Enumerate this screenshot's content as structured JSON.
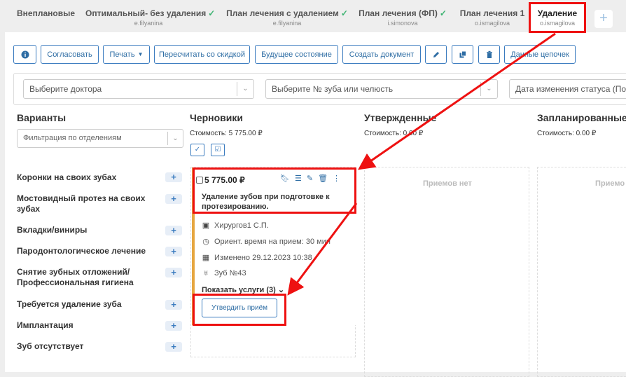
{
  "tabs": [
    {
      "title": "Внеплановые",
      "sub": "",
      "check": false
    },
    {
      "title": "Оптимальный- без удаления",
      "sub": "e.filyanina",
      "check": true
    },
    {
      "title": "План лечения с удалением",
      "sub": "e.filyanina",
      "check": true
    },
    {
      "title": "План лечения (ФП)",
      "sub": "i.simonova",
      "check": true
    },
    {
      "title": "План лечения 1",
      "sub": "o.ismagilova",
      "check": false
    },
    {
      "title": "Удаление",
      "sub": "o.ismagilova",
      "check": false,
      "active": true
    }
  ],
  "add_tab": "+",
  "toolbar": {
    "agree": "Согласовать",
    "print": "Печать",
    "recalc": "Пересчитать со скидкой",
    "future": "Будущее состояние",
    "create_doc": "Создать документ",
    "chain_data": "Данные цепочек"
  },
  "selects": {
    "doctor": "Выберите доктора",
    "tooth": "Выберите № зуба или челюсть",
    "date": "Дата изменения статуса (По убыванию)"
  },
  "variants": {
    "title": "Варианты",
    "filter_placeholder": "Фильтрация по отделениям",
    "categories": [
      "Коронки на своих зубах",
      "Мостовидный протез на своих зубах",
      "Вкладки/виниры",
      "Пародонтологическое лечение",
      "Снятие зубных отложений/ Профессиональная гигиена",
      "Требуется удаление зуба",
      "Имплантация",
      "Зуб отсутствует"
    ]
  },
  "columns": {
    "drafts": {
      "title": "Черновики",
      "cost": "Стоимость: 5 775.00 ₽"
    },
    "approved": {
      "title": "Утвержденные",
      "cost": "Стоимость: 0.00 ₽",
      "empty": "Приемов нет"
    },
    "planned": {
      "title": "Запланированные",
      "cost": "Стоимость: 0.00 ₽",
      "empty": "Приемо"
    }
  },
  "card": {
    "price": "5 775.00 ₽",
    "description": "Удаление зубов при подготовке к протезированию.",
    "doctor": "Хирургов1 С.П.",
    "duration": "Ориент. время на прием: 30 мин",
    "changed": "Изменено 29.12.2023 10:38",
    "tooth": "Зуб №43",
    "show_services": "Показать услуги (3)",
    "approve": "Утвердить приём"
  },
  "colors": {
    "accent": "#2e6da4",
    "annotation": "#e11111",
    "card_border": "#e6a640"
  }
}
